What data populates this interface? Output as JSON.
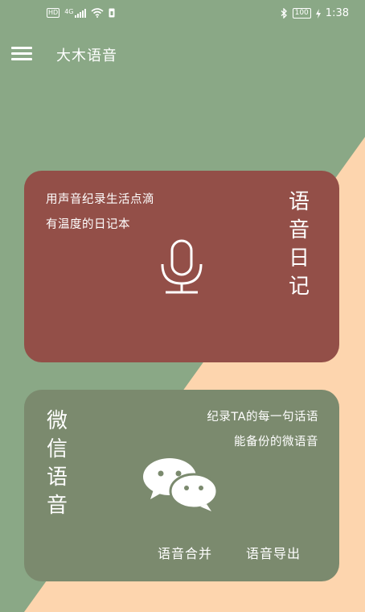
{
  "status_bar": {
    "left": [
      "HD",
      "4G",
      "signal-icon",
      "wifi-icon",
      "sim-icon"
    ],
    "hd": "HD",
    "network": "4G",
    "battery": "100",
    "time": "1:38",
    "icons": [
      "bluetooth-icon",
      "battery-icon",
      "charging-icon"
    ]
  },
  "header": {
    "title": "大木语音",
    "menu_icon": "menu-icon"
  },
  "diary_card": {
    "line1": "用声音纪录生活点滴",
    "line2": "有温度的日记本",
    "vertical_title": "语音日记",
    "icon": "microphone-icon",
    "color": "#934f48"
  },
  "wechat_card": {
    "vertical_title": "微信语音",
    "line1": "纪录TA的每一句话语",
    "line2": "能备份的微语音",
    "icon": "wechat-icon",
    "merge_label": "语音合并",
    "export_label": "语音导出",
    "color": "#7b8a6e"
  },
  "colors": {
    "background_green": "#8aa886",
    "background_peach": "#fdd5ae"
  }
}
